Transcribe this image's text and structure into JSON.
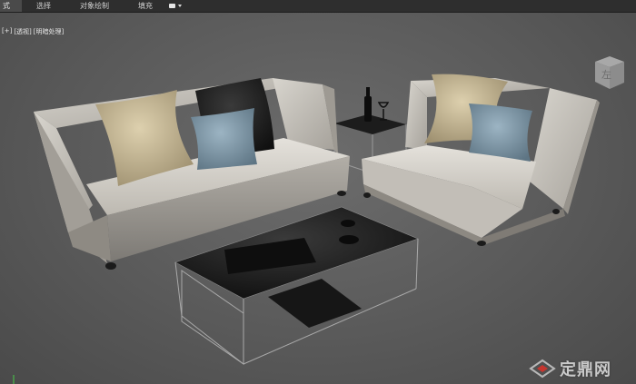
{
  "ribbon": {
    "tabs": [
      {
        "label": "式",
        "active": true
      },
      {
        "label": "选择",
        "active": false
      },
      {
        "label": "对象绘制",
        "active": false
      },
      {
        "label": "填充",
        "active": false
      }
    ],
    "view_dropdown_icon": "camera-dropdown-icon"
  },
  "viewport": {
    "label_plus": "[+]",
    "label_view": "[透视]",
    "label_shading": "[明暗处理]",
    "viewcube_face": "左"
  },
  "watermark": {
    "text": "定鼎网",
    "logo_icon": "dingding-logo-icon"
  },
  "colors": {
    "ribbon_bg": "#2e2e2e",
    "viewport_bg": "#5d5d5d",
    "sofa": "#cfcbc3",
    "pillow_beige": "#c9bb98",
    "pillow_blue": "#7e98a8",
    "pillow_black": "#1e1e1e",
    "table_top": "#151515"
  }
}
